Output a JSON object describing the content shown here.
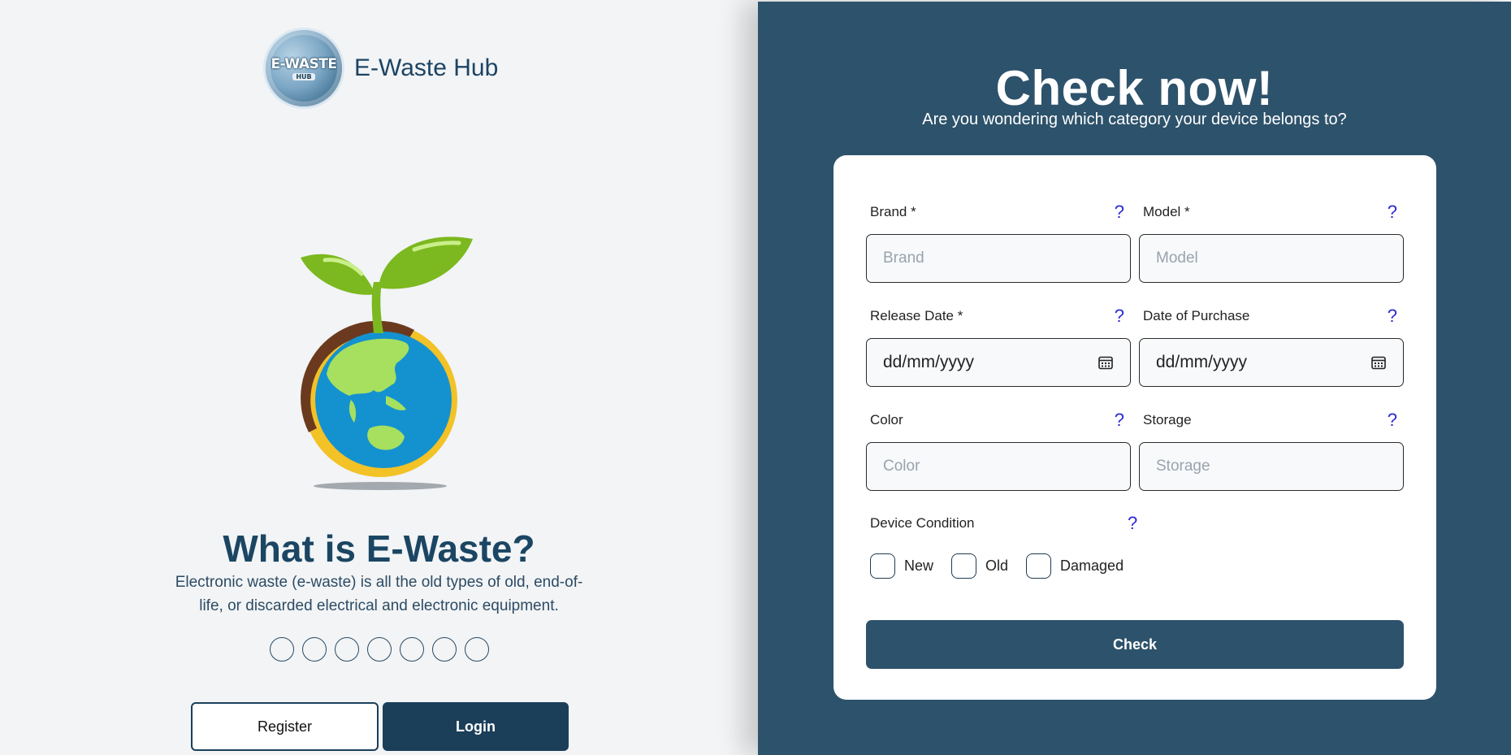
{
  "header": {
    "logo_text": "E-WASTE",
    "logo_sub": "HUB",
    "brand_name": "E-Waste Hub"
  },
  "hero": {
    "image": "earth-with-sprout-illustration"
  },
  "info": {
    "title": "What is E-Waste?",
    "description": "Electronic waste (e-waste) is all the old types of old, end-of-life, or discarded electrical and electronic equipment.",
    "carousel_dot_count": 7
  },
  "auth": {
    "register_label": "Register",
    "login_label": "Login"
  },
  "check": {
    "title": "Check now!",
    "subtitle": "Are you wondering which category your device belongs to?",
    "help_glyph": "?",
    "fields": {
      "brand": {
        "label": "Brand *",
        "placeholder": "Brand"
      },
      "model": {
        "label": "Model *",
        "placeholder": "Model"
      },
      "release_date": {
        "label": "Release Date *",
        "placeholder": "dd/mm/yyyy"
      },
      "purchase_date": {
        "label": "Date of Purchase",
        "placeholder": "dd/mm/yyyy"
      },
      "color": {
        "label": "Color",
        "placeholder": "Color"
      },
      "storage": {
        "label": "Storage",
        "placeholder": "Storage"
      }
    },
    "condition": {
      "label": "Device Condition",
      "options": [
        "New",
        "Old",
        "Damaged"
      ]
    },
    "submit_label": "Check"
  },
  "colors": {
    "primary_dark": "#1b3f59",
    "panel": "#2d526b",
    "background": "#f2f4f6",
    "help_blue": "#2a2ad8"
  }
}
